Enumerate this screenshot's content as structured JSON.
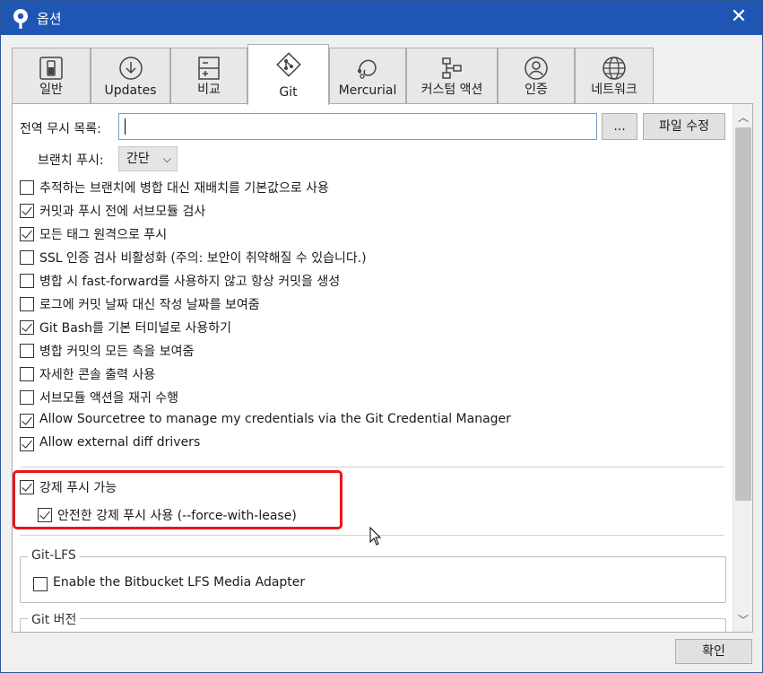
{
  "window": {
    "title": "옵션"
  },
  "tabs": [
    {
      "label": "일반",
      "icon": "general-icon"
    },
    {
      "label": "Updates",
      "icon": "updates-icon"
    },
    {
      "label": "비교",
      "icon": "diff-icon"
    },
    {
      "label": "Git",
      "icon": "git-icon",
      "active": true
    },
    {
      "label": "Mercurial",
      "icon": "mercurial-icon"
    },
    {
      "label": "커스텀 액션",
      "icon": "custom-actions-icon"
    },
    {
      "label": "인증",
      "icon": "auth-icon"
    },
    {
      "label": "네트워크",
      "icon": "network-icon"
    }
  ],
  "git": {
    "global_ignore_label": "전역 무시 목록:",
    "global_ignore_value": "",
    "browse_label": "...",
    "edit_file_label": "파일 수정",
    "branch_push_label": "브랜치 푸시:",
    "branch_push_value": "간단",
    "options": [
      {
        "label": "추적하는 브랜치에 병합 대신 재배치를 기본값으로 사용",
        "checked": false
      },
      {
        "label": "커밋과 푸시 전에 서브모듈 검사",
        "checked": true
      },
      {
        "label": "모든 태그 원격으로 푸시",
        "checked": true
      },
      {
        "label": "SSL 인증 검사 비활성화 (주의: 보안이 취약해질 수 있습니다.)",
        "checked": false
      },
      {
        "label": "병합 시 fast-forward를 사용하지 않고 항상 커밋을 생성",
        "checked": false
      },
      {
        "label": "로그에 커밋 날짜 대신 작성 날짜를 보여줌",
        "checked": false
      },
      {
        "label": "Git Bash를 기본 터미널로 사용하기",
        "checked": true
      },
      {
        "label": "병합 커밋의 모든 측을 보여줌",
        "checked": false
      },
      {
        "label": "자세한 콘솔 출력 사용",
        "checked": false
      },
      {
        "label": "서브모듈 액션을 재귀 수행",
        "checked": false
      },
      {
        "label": "Allow Sourcetree to manage my credentials via the Git Credential Manager",
        "checked": true
      },
      {
        "label": "Allow external diff drivers",
        "checked": true
      }
    ],
    "force_push": {
      "label": "강제 푸시 가능",
      "checked": true
    },
    "force_with_lease": {
      "label": "안전한 강제 푸시 사용 (--force-with-lease)",
      "checked": true
    },
    "lfs_group": {
      "title": "Git-LFS",
      "option": {
        "label": "Enable the Bitbucket LFS Media Adapter",
        "checked": false
      }
    },
    "version_group": {
      "title": "Git 버전"
    }
  },
  "footer": {
    "ok_label": "확인"
  },
  "colors": {
    "titlebar": "#1f55b3",
    "highlight": "#e8141e"
  }
}
